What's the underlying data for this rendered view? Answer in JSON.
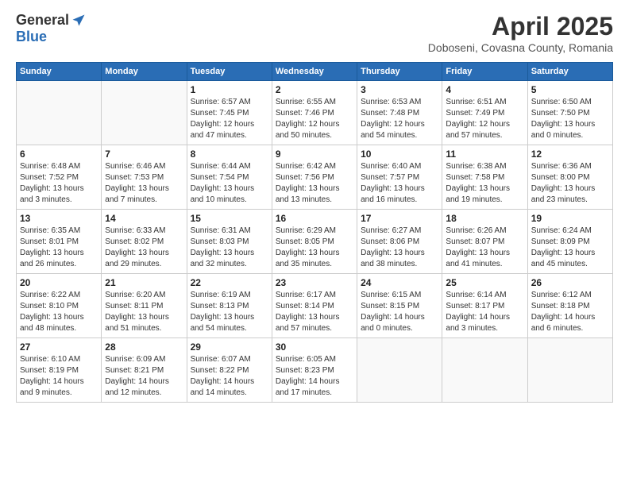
{
  "logo": {
    "general": "General",
    "blue": "Blue"
  },
  "title": "April 2025",
  "location": "Doboseni, Covasna County, Romania",
  "days_of_week": [
    "Sunday",
    "Monday",
    "Tuesday",
    "Wednesday",
    "Thursday",
    "Friday",
    "Saturday"
  ],
  "weeks": [
    [
      {
        "day": "",
        "info": ""
      },
      {
        "day": "",
        "info": ""
      },
      {
        "day": "1",
        "info": "Sunrise: 6:57 AM\nSunset: 7:45 PM\nDaylight: 12 hours and 47 minutes."
      },
      {
        "day": "2",
        "info": "Sunrise: 6:55 AM\nSunset: 7:46 PM\nDaylight: 12 hours and 50 minutes."
      },
      {
        "day": "3",
        "info": "Sunrise: 6:53 AM\nSunset: 7:48 PM\nDaylight: 12 hours and 54 minutes."
      },
      {
        "day": "4",
        "info": "Sunrise: 6:51 AM\nSunset: 7:49 PM\nDaylight: 12 hours and 57 minutes."
      },
      {
        "day": "5",
        "info": "Sunrise: 6:50 AM\nSunset: 7:50 PM\nDaylight: 13 hours and 0 minutes."
      }
    ],
    [
      {
        "day": "6",
        "info": "Sunrise: 6:48 AM\nSunset: 7:52 PM\nDaylight: 13 hours and 3 minutes."
      },
      {
        "day": "7",
        "info": "Sunrise: 6:46 AM\nSunset: 7:53 PM\nDaylight: 13 hours and 7 minutes."
      },
      {
        "day": "8",
        "info": "Sunrise: 6:44 AM\nSunset: 7:54 PM\nDaylight: 13 hours and 10 minutes."
      },
      {
        "day": "9",
        "info": "Sunrise: 6:42 AM\nSunset: 7:56 PM\nDaylight: 13 hours and 13 minutes."
      },
      {
        "day": "10",
        "info": "Sunrise: 6:40 AM\nSunset: 7:57 PM\nDaylight: 13 hours and 16 minutes."
      },
      {
        "day": "11",
        "info": "Sunrise: 6:38 AM\nSunset: 7:58 PM\nDaylight: 13 hours and 19 minutes."
      },
      {
        "day": "12",
        "info": "Sunrise: 6:36 AM\nSunset: 8:00 PM\nDaylight: 13 hours and 23 minutes."
      }
    ],
    [
      {
        "day": "13",
        "info": "Sunrise: 6:35 AM\nSunset: 8:01 PM\nDaylight: 13 hours and 26 minutes."
      },
      {
        "day": "14",
        "info": "Sunrise: 6:33 AM\nSunset: 8:02 PM\nDaylight: 13 hours and 29 minutes."
      },
      {
        "day": "15",
        "info": "Sunrise: 6:31 AM\nSunset: 8:03 PM\nDaylight: 13 hours and 32 minutes."
      },
      {
        "day": "16",
        "info": "Sunrise: 6:29 AM\nSunset: 8:05 PM\nDaylight: 13 hours and 35 minutes."
      },
      {
        "day": "17",
        "info": "Sunrise: 6:27 AM\nSunset: 8:06 PM\nDaylight: 13 hours and 38 minutes."
      },
      {
        "day": "18",
        "info": "Sunrise: 6:26 AM\nSunset: 8:07 PM\nDaylight: 13 hours and 41 minutes."
      },
      {
        "day": "19",
        "info": "Sunrise: 6:24 AM\nSunset: 8:09 PM\nDaylight: 13 hours and 45 minutes."
      }
    ],
    [
      {
        "day": "20",
        "info": "Sunrise: 6:22 AM\nSunset: 8:10 PM\nDaylight: 13 hours and 48 minutes."
      },
      {
        "day": "21",
        "info": "Sunrise: 6:20 AM\nSunset: 8:11 PM\nDaylight: 13 hours and 51 minutes."
      },
      {
        "day": "22",
        "info": "Sunrise: 6:19 AM\nSunset: 8:13 PM\nDaylight: 13 hours and 54 minutes."
      },
      {
        "day": "23",
        "info": "Sunrise: 6:17 AM\nSunset: 8:14 PM\nDaylight: 13 hours and 57 minutes."
      },
      {
        "day": "24",
        "info": "Sunrise: 6:15 AM\nSunset: 8:15 PM\nDaylight: 14 hours and 0 minutes."
      },
      {
        "day": "25",
        "info": "Sunrise: 6:14 AM\nSunset: 8:17 PM\nDaylight: 14 hours and 3 minutes."
      },
      {
        "day": "26",
        "info": "Sunrise: 6:12 AM\nSunset: 8:18 PM\nDaylight: 14 hours and 6 minutes."
      }
    ],
    [
      {
        "day": "27",
        "info": "Sunrise: 6:10 AM\nSunset: 8:19 PM\nDaylight: 14 hours and 9 minutes."
      },
      {
        "day": "28",
        "info": "Sunrise: 6:09 AM\nSunset: 8:21 PM\nDaylight: 14 hours and 12 minutes."
      },
      {
        "day": "29",
        "info": "Sunrise: 6:07 AM\nSunset: 8:22 PM\nDaylight: 14 hours and 14 minutes."
      },
      {
        "day": "30",
        "info": "Sunrise: 6:05 AM\nSunset: 8:23 PM\nDaylight: 14 hours and 17 minutes."
      },
      {
        "day": "",
        "info": ""
      },
      {
        "day": "",
        "info": ""
      },
      {
        "day": "",
        "info": ""
      }
    ]
  ]
}
